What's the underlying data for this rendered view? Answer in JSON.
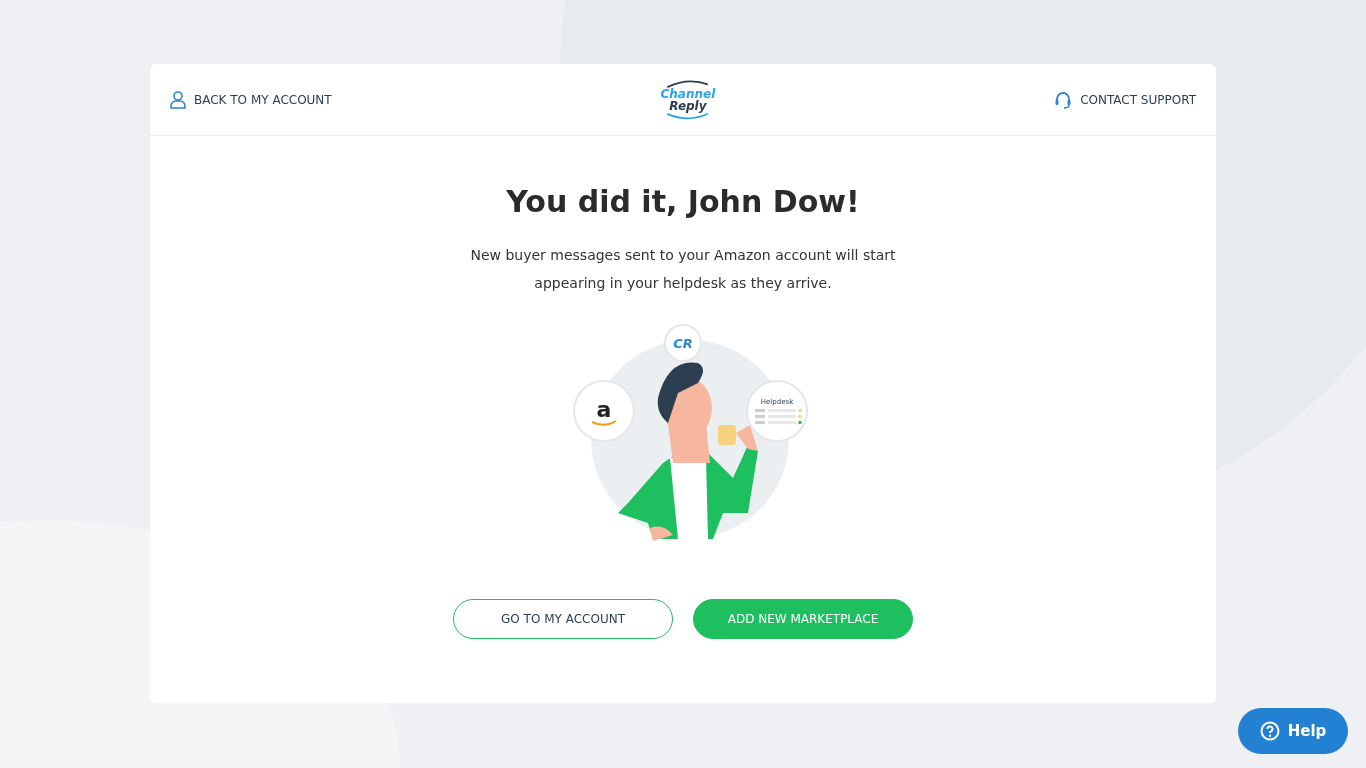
{
  "header": {
    "back_link": "BACK TO MY ACCOUNT",
    "logo": {
      "primary": "Channel",
      "secondary": "Reply"
    },
    "support_link": "CONTACT SUPPORT"
  },
  "main": {
    "title": "You did it, John Dow!",
    "message": "New buyer messages sent to your Amazon account will start appearing in your helpdesk as they arrive.",
    "illustration": {
      "cr_badge": "CR",
      "amazon_badge": "a",
      "helpdesk_title": "Helpdesk"
    },
    "buttons": [
      {
        "label": "GO TO MY ACCOUNT",
        "kind": "outline"
      },
      {
        "label": "ADD NEW MARKETPLACE",
        "kind": "filled"
      }
    ]
  },
  "help_button": "Help"
}
